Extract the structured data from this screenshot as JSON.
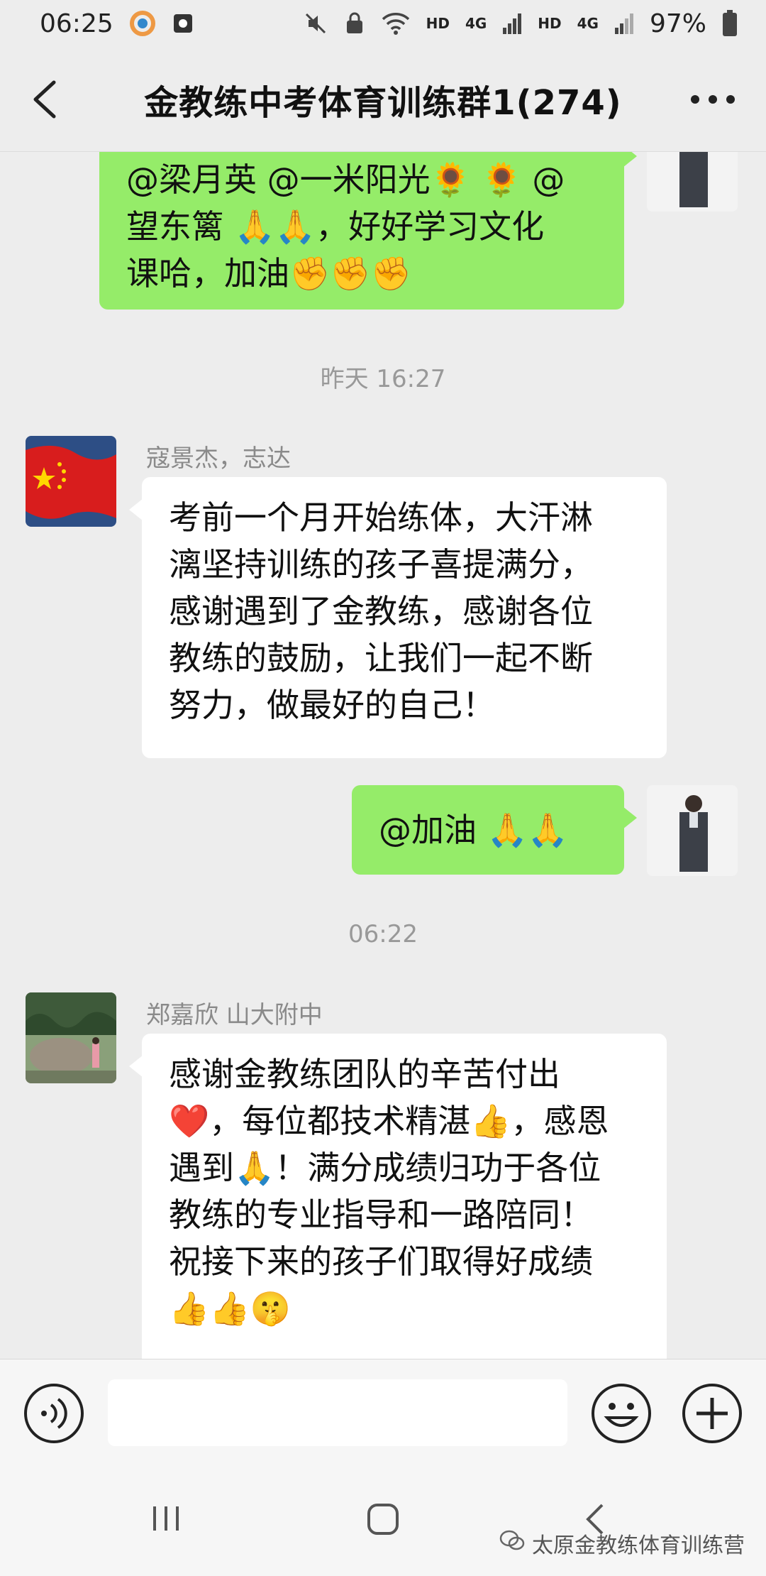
{
  "status_bar": {
    "time": "06:25",
    "battery": "97%",
    "net1": "HD",
    "net2": "4G",
    "net3": "HD",
    "net4": "4G"
  },
  "header": {
    "title": "金教练中考体育训练群1(274)"
  },
  "messages": [
    {
      "type": "outgoing",
      "lines": [
        "@梁月英  @一米阳光🌻 🌻 @",
        "望东篱  🙏🙏，好好学习文化",
        "课哈，加油✊✊✊"
      ]
    },
    {
      "type": "time",
      "text": "昨天 16:27"
    },
    {
      "type": "incoming",
      "sender": "寇景杰，志达",
      "lines": [
        "考前一个月开始练体，大汗淋",
        "漓坚持训练的孩子喜提满分，",
        "感谢遇到了金教练，感谢各位",
        "教练的鼓励，让我们一起不断",
        "努力，做最好的自己！"
      ]
    },
    {
      "type": "outgoing",
      "lines": [
        "@加油  🙏🙏"
      ]
    },
    {
      "type": "time",
      "text": "06:22"
    },
    {
      "type": "incoming",
      "sender": "郑嘉欣 山大附中",
      "lines": [
        "感谢金教练团队的辛苦付出",
        "❤️，每位都技术精湛👍，感恩",
        "遇到🙏！满分成绩归功于各位",
        "教练的专业指导和一路陪同！",
        "祝接下来的孩子们取得好成绩",
        "👍👍🤫"
      ]
    }
  ],
  "watermark": "太原金教练体育训练营",
  "colors": {
    "outgoing_bubble": "#95ec69",
    "incoming_bubble": "#ffffff",
    "background": "#ededed"
  }
}
